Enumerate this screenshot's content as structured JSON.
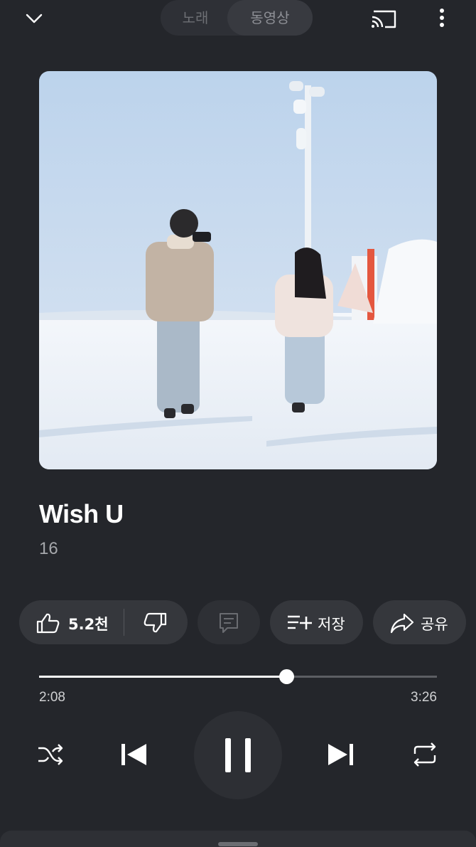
{
  "header": {
    "tabs": [
      {
        "label": "노래",
        "selected": false
      },
      {
        "label": "동영상",
        "selected": true
      }
    ],
    "icons": {
      "collapse": "chevron-down-icon",
      "cast": "cast-icon",
      "menu": "more-vert-icon"
    }
  },
  "track": {
    "title": "Wish U",
    "artist": "16"
  },
  "actions": {
    "like_count": "5.2천",
    "save_label": "저장",
    "share_label": "공유"
  },
  "playback": {
    "current_time": "2:08",
    "total_time": "3:26",
    "progress": 0.621,
    "state": "playing"
  },
  "colors": {
    "background": "#24262b",
    "pill": "#35373c",
    "text_secondary": "#a5a7ab"
  }
}
